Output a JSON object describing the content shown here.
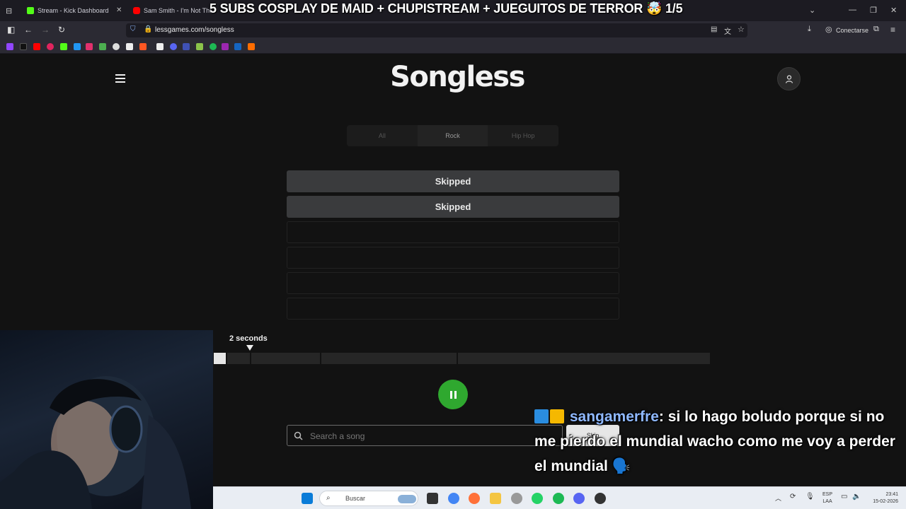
{
  "browser": {
    "tabs": [
      {
        "title": "Stream - Kick Dashboard",
        "favicon_color": "#53fc18"
      },
      {
        "title": "Sam Smith - I'm Not The Only One",
        "favicon_color": "#ff0000"
      }
    ],
    "url": "lessgames.com/songless",
    "account_label": "Conectarse"
  },
  "stream_overlay": {
    "title": "5 SUBS COSPLAY DE MAID + CHUPISTREAM + JUEGUITOS DE TERROR 🤯 1/5"
  },
  "page": {
    "logo": "Songless",
    "genres": [
      {
        "label": "All",
        "active": false
      },
      {
        "label": "Rock",
        "active": true
      },
      {
        "label": "Hip Hop",
        "active": false
      }
    ],
    "guesses": [
      "Skipped",
      "Skipped",
      "",
      "",
      "",
      ""
    ],
    "player": {
      "duration_label": "2 seconds",
      "progress": 0.024
    },
    "search": {
      "placeholder": "Search a song",
      "skip_label": "Skip"
    }
  },
  "chat": {
    "username": "sangamerfre",
    "message": ": si lo hago boludo porque si no me pierdo el mundial wacho como me voy a perder el mundial 🗣️"
  },
  "taskbar": {
    "search_label": "Buscar",
    "lang_top": "ESP",
    "lang_bottom": "LAA",
    "time": "23:41",
    "date": "15-02-2026"
  }
}
